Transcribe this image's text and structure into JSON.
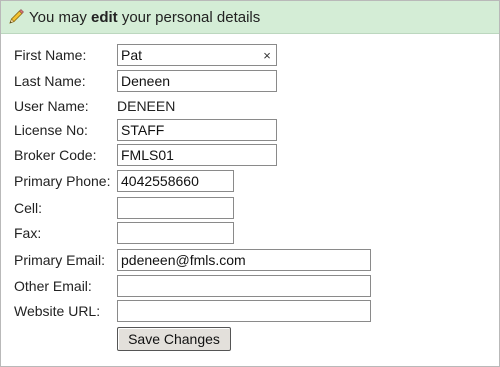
{
  "header": {
    "prefix": "You may ",
    "emphasis": "edit",
    "suffix": " your personal details"
  },
  "fields": {
    "first_name": {
      "label": "First Name:",
      "value": "Pat"
    },
    "last_name": {
      "label": "Last Name:",
      "value": "Deneen"
    },
    "user_name": {
      "label": "User Name:",
      "value": "DENEEN"
    },
    "license_no": {
      "label": "License No:",
      "value": "STAFF"
    },
    "broker_code": {
      "label": "Broker Code:",
      "value": "FMLS01"
    },
    "primary_phone": {
      "label": "Primary Phone:",
      "value": "4042558660"
    },
    "cell": {
      "label": "Cell:",
      "value": ""
    },
    "fax": {
      "label": "Fax:",
      "value": ""
    },
    "primary_email": {
      "label": "Primary Email:",
      "value": "pdeneen@fmls.com"
    },
    "other_email": {
      "label": "Other Email:",
      "value": ""
    },
    "website_url": {
      "label": "Website URL:",
      "value": ""
    }
  },
  "clear_glyph": "×",
  "save_label": "Save Changes",
  "icons": {
    "header_icon": "pencil-icon",
    "clear_icon": "close-icon"
  },
  "colors": {
    "header_bg": "#d4edd6",
    "button_bg": "#e3e0db"
  }
}
